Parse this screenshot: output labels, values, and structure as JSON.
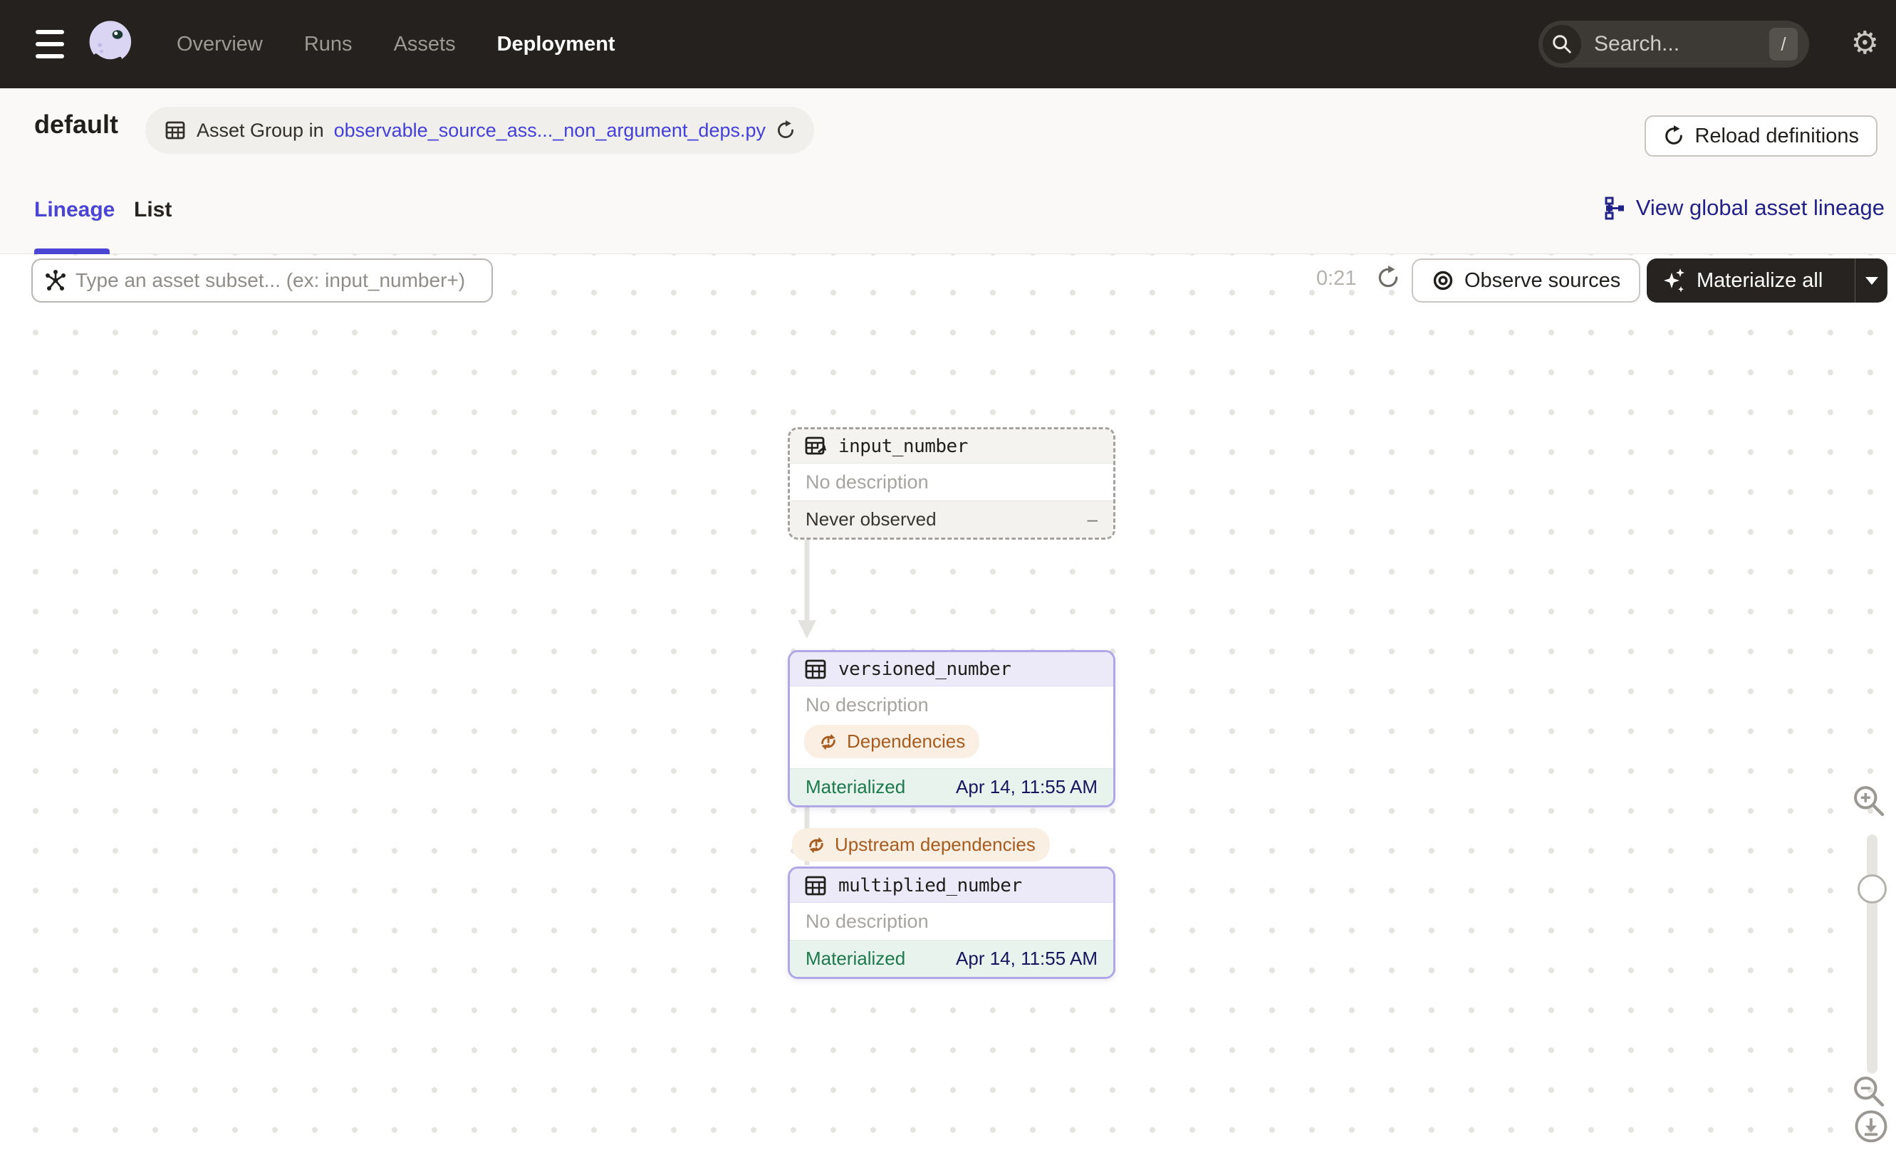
{
  "nav": {
    "items": [
      {
        "label": "Overview",
        "active": false
      },
      {
        "label": "Runs",
        "active": false
      },
      {
        "label": "Assets",
        "active": false
      },
      {
        "label": "Deployment",
        "active": true
      }
    ],
    "search": {
      "placeholder": "Search...",
      "shortcut_key": "/"
    }
  },
  "header": {
    "title": "default",
    "breadcrumb": {
      "prefix": "Asset Group in",
      "link_text": "observable_source_ass..._non_argument_deps.py"
    },
    "reload_button_label": "Reload definitions"
  },
  "tabs": {
    "items": [
      {
        "label": "Lineage",
        "active": true
      },
      {
        "label": "List",
        "active": false
      }
    ],
    "global_lineage_link": "View global asset lineage"
  },
  "toolbar": {
    "filter_placeholder": "Type an asset subset... (ex: input_number+)",
    "elapsed_time": "0:21",
    "observe_button_label": "Observe sources",
    "materialize_button_label": "Materialize all"
  },
  "graph": {
    "nodes": [
      {
        "name": "input_number",
        "type": "observable-source",
        "description": "No description",
        "status_label": "Never observed",
        "status_value": "–"
      },
      {
        "name": "versioned_number",
        "type": "materializable",
        "description": "No description",
        "warning_badge": "Dependencies",
        "status_label": "Materialized",
        "status_value": "Apr 14, 11:55 AM"
      },
      {
        "name": "multiplied_number",
        "type": "materializable",
        "description": "No description",
        "status_label": "Materialized",
        "status_value": "Apr 14, 11:55 AM"
      }
    ],
    "edge_badge": "Upstream dependencies"
  },
  "icons": {
    "settings_gear": "⚙"
  },
  "colors": {
    "nav_background": "#24211E",
    "accent_purple": "#4A45D2",
    "link_blue": "#4340D9",
    "link_navy": "#222288",
    "asset_border_purple": "#AFA7E6",
    "asset_header_purple": "#ECEAF8",
    "materialized_green": "#1C7A4A",
    "materialized_row_bg": "#E9F3EE",
    "timestamp_navy": "#16165E",
    "warning_orange": "#A85B1E",
    "warning_badge_bg": "#FAEFE2"
  }
}
